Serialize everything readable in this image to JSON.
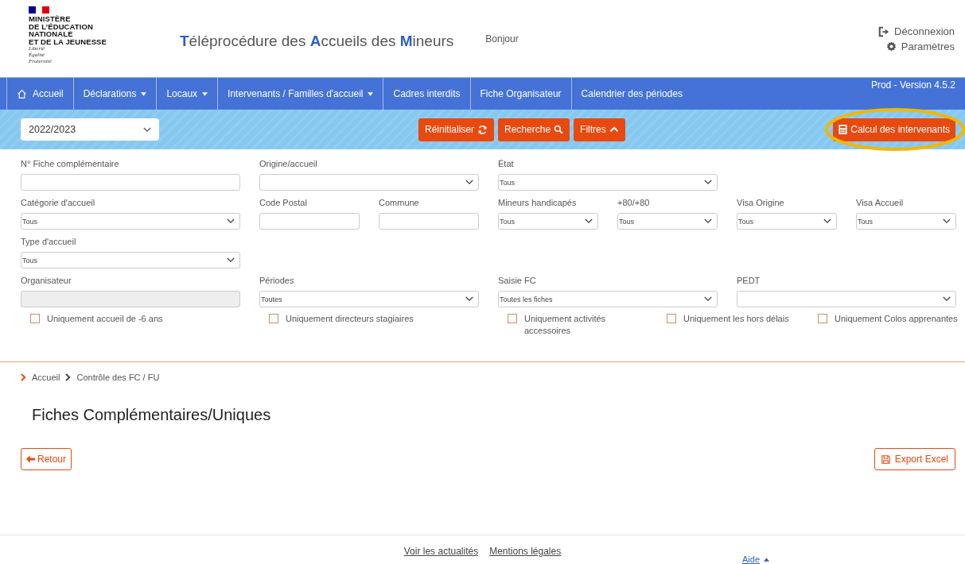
{
  "header": {
    "logo_lines": [
      "MINISTÈRE",
      "DE L’ÉDUCATION",
      "NATIONALE",
      "ET DE LA JEUNESSE"
    ],
    "motto": [
      "Liberté",
      "Égalité",
      "Fraternité"
    ],
    "title": "**T**éléprocédure des **A**ccueils des **M**ineurs",
    "greeting": "Bonjour",
    "links": [
      {
        "kind": "logout",
        "label": "Déconnexion"
      },
      {
        "kind": "settings",
        "label": "Paramètres"
      }
    ]
  },
  "nav": {
    "items": [
      {
        "label": "Accueil",
        "kind": "home"
      },
      {
        "label": "Déclarations",
        "kind": "dropdown"
      },
      {
        "label": "Locaux",
        "kind": "dropdown"
      },
      {
        "label": "Intervenants / Familles d'accueil",
        "kind": "dropdown"
      },
      {
        "label": "Cadres interdits",
        "kind": "link"
      },
      {
        "label": "Fiche Organisateur",
        "kind": "link"
      },
      {
        "label": "Calendrier des périodes",
        "kind": "link"
      }
    ],
    "version": "Prod - Version 4.5.2"
  },
  "toolbar": {
    "year": "2022/2023",
    "buttons": [
      {
        "label": "Réinitialiser",
        "kind": "reset"
      },
      {
        "label": "Recherche",
        "kind": "search"
      },
      {
        "label": "Filtres",
        "kind": "collapse"
      }
    ],
    "calc_button": {
      "label": "Calcul des intervenants",
      "highlighted": true
    }
  },
  "filters": {
    "rows": [
      [
        {
          "label": "N° Fiche complémentaire",
          "kind": "input"
        },
        {
          "label": "Origine/accueil",
          "kind": "select"
        },
        {
          "label": "État",
          "kind": "select",
          "value": "Tous"
        }
      ],
      [
        {
          "label": "Catégorie d'accueil",
          "kind": "select",
          "value": "Tous"
        },
        {
          "kind": "pair",
          "fields": [
            {
              "label": "Code Postal",
              "kind": "input"
            },
            {
              "label": "Commune",
              "kind": "input"
            }
          ]
        },
        {
          "kind": "pair",
          "fields": [
            {
              "label": "Mineurs handicapés",
              "kind": "select",
              "value": "Tous"
            },
            {
              "label": "+80/+80",
              "kind": "select",
              "value": "Tous"
            }
          ]
        },
        {
          "kind": "pair",
          "fields": [
            {
              "label": "Visa Origine",
              "kind": "select",
              "value": "Tous"
            },
            {
              "label": "Visa Accueil",
              "kind": "select",
              "value": "Tous"
            }
          ]
        }
      ],
      [
        {
          "label": "Type d'accueil",
          "kind": "select",
          "value": "Tous"
        }
      ],
      [
        {
          "label": "Organisateur",
          "kind": "disabled"
        },
        {
          "label": "Périodes",
          "kind": "select",
          "value": "Toutes"
        },
        {
          "label": "Saisie FC",
          "kind": "select",
          "value": "Toutes les fiches"
        },
        {
          "label": "PEDT",
          "kind": "select"
        }
      ]
    ],
    "checkboxes": [
      {
        "label": "Uniquement accueil de -6 ans",
        "checked": false
      },
      {
        "label": "Uniquement directeurs stagiaires",
        "checked": false
      },
      {
        "label": "Uniquement activités accessoires",
        "checked": false
      },
      {
        "label": "Uniquement les hors délais",
        "checked": false
      },
      {
        "label": "Uniquement Colos apprenantes",
        "checked": false
      }
    ]
  },
  "breadcrumb": [
    "Accueil",
    "Contrôle des FC / FU"
  ],
  "heading": "Fiches Complémentaires/Uniques",
  "actions": [
    {
      "label": "Retour",
      "kind": "back"
    },
    {
      "label": "Export Excel",
      "kind": "export"
    }
  ],
  "footer": {
    "links": [
      "Voir les actualités",
      "Mentions légales"
    ],
    "help": "Aide"
  }
}
